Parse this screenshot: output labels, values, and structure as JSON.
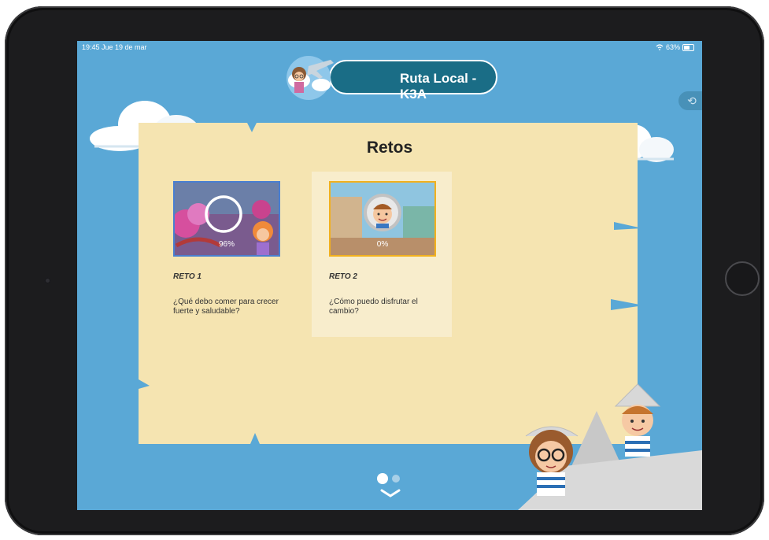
{
  "status_bar": {
    "time_date": "19:45  Jue 19 de mar",
    "battery": "63%"
  },
  "header": {
    "title": "Ruta Local - K3A"
  },
  "section": {
    "title": "Retos"
  },
  "challenges": [
    {
      "label": "RETO 1",
      "description": "¿Qué debo comer para crecer fuerte y saludable?",
      "progress_text": "96%",
      "progress": 96,
      "border_color": "#4a7fd0"
    },
    {
      "label": "RETO 2",
      "description": "¿Cómo puedo disfrutar el cambio?",
      "progress_text": "0%",
      "progress": 0,
      "border_color": "#f2b11e"
    }
  ],
  "pagination": {
    "current": 1,
    "total": 2
  },
  "colors": {
    "sky": "#5aa8d6",
    "paper": "#f5e4b1",
    "header_pill": "#1a6d86"
  },
  "icons": {
    "refresh": "refresh-icon",
    "chevron": "chevron-down-icon",
    "wifi": "wifi-icon",
    "battery": "battery-icon"
  }
}
